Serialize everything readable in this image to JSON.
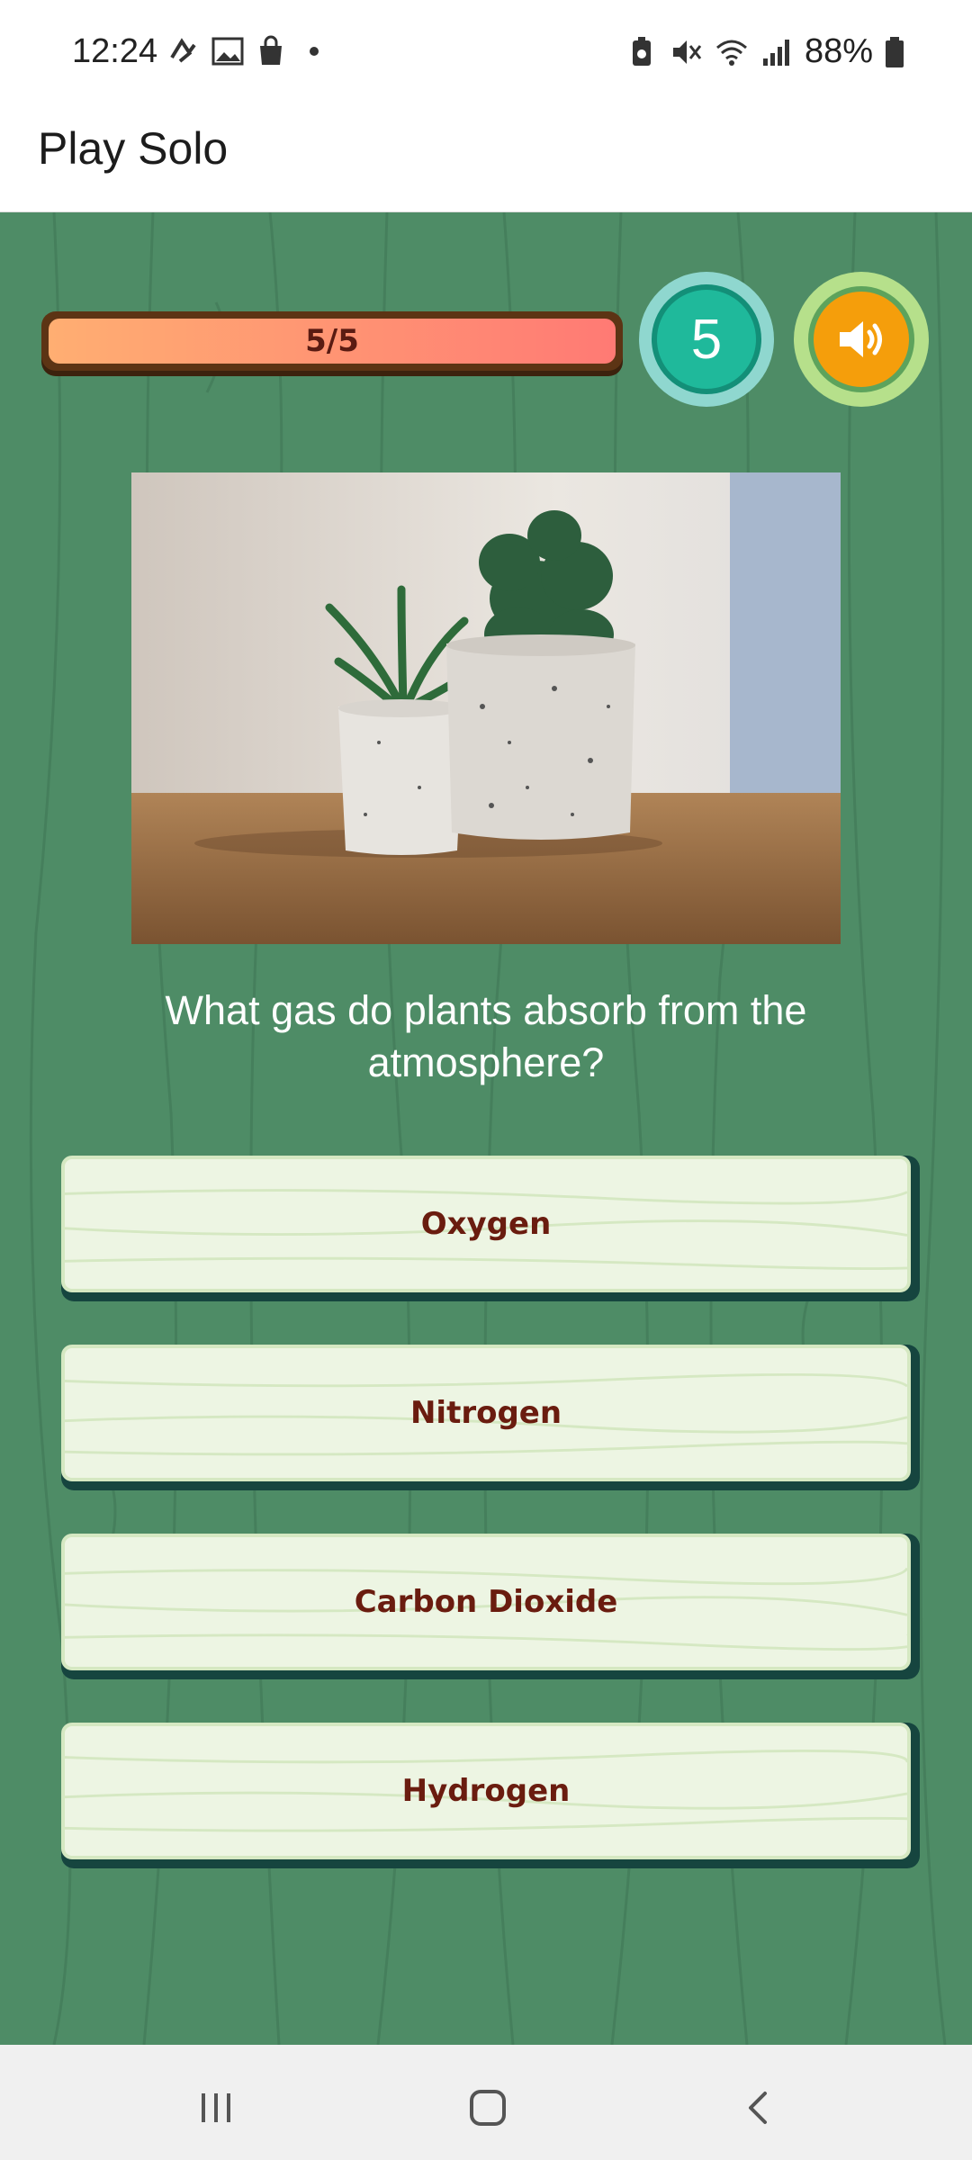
{
  "status_bar": {
    "time": "12:24",
    "battery": "88%",
    "left_icons": [
      "activity-icon",
      "gallery-icon",
      "shopping-bag-icon",
      "dot-icon"
    ],
    "right_icons": [
      "battery-saver-icon",
      "mute-icon",
      "wifi-icon",
      "signal-icon",
      "battery-icon"
    ]
  },
  "app_bar": {
    "title": "Play Solo"
  },
  "game": {
    "progress": {
      "label": "5/5",
      "fraction": 1.0
    },
    "timer": {
      "value": "5"
    },
    "sound_icon": "speaker-icon",
    "question": "What gas do plants absorb from the atmosphere?",
    "answers": [
      {
        "label": "Oxygen"
      },
      {
        "label": "Nitrogen"
      },
      {
        "label": "Carbon Dioxide"
      },
      {
        "label": "Hydrogen"
      }
    ],
    "colors": {
      "background": "#4e8c66",
      "progress_fill": "#ff8a73",
      "timer": "#1fb99b",
      "sound": "#f59e0b",
      "answer_text": "#6a1c0f"
    }
  },
  "nav_bar": {
    "buttons": [
      "recent-apps-icon",
      "home-icon",
      "back-icon"
    ]
  }
}
